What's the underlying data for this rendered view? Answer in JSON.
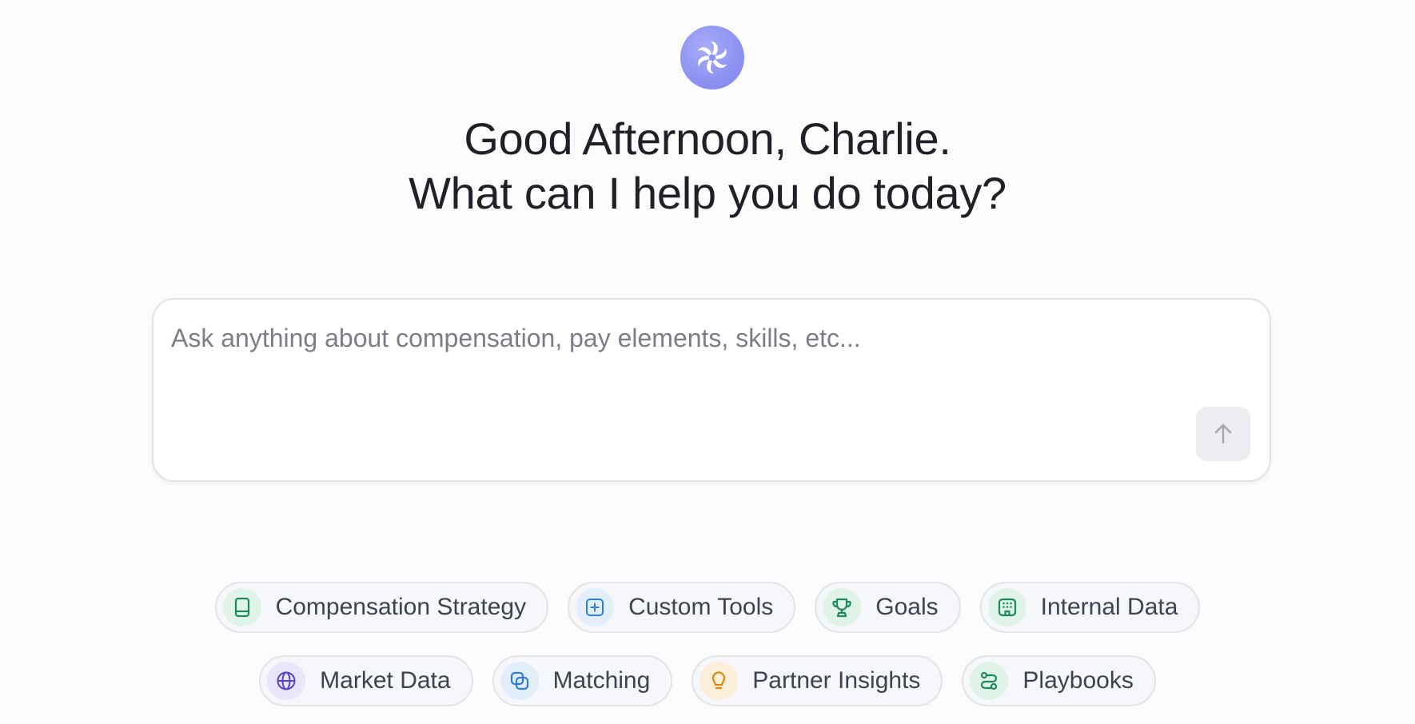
{
  "greeting": {
    "line1": "Good Afternoon, Charlie.",
    "line2": "What can I help you do today?"
  },
  "composer": {
    "placeholder": "Ask anything about compensation, pay elements, skills, etc...",
    "value": "",
    "send_icon": "arrow-up-icon"
  },
  "suggestions": {
    "row1": [
      {
        "label": "Compensation Strategy",
        "icon": "book-icon",
        "color": "#1f8a5b",
        "bg": "#dff3e8"
      },
      {
        "label": "Custom Tools",
        "icon": "plus-square-icon",
        "color": "#2f7fd8",
        "bg": "#e3eefb"
      },
      {
        "label": "Goals",
        "icon": "trophy-icon",
        "color": "#1f8a5b",
        "bg": "#dff3e8"
      },
      {
        "label": "Internal Data",
        "icon": "building-grid-icon",
        "color": "#1f8a5b",
        "bg": "#dff3e8"
      }
    ],
    "row2": [
      {
        "label": "Market Data",
        "icon": "globe-icon",
        "color": "#5a3fd0",
        "bg": "#e9e5fa"
      },
      {
        "label": "Matching",
        "icon": "overlap-squares-icon",
        "color": "#2f7fd8",
        "bg": "#e3eefb"
      },
      {
        "label": "Partner Insights",
        "icon": "lightbulb-icon",
        "color": "#d98a12",
        "bg": "#fcefd9"
      },
      {
        "label": "Playbooks",
        "icon": "route-icon",
        "color": "#1f8a5b",
        "bg": "#dff3e8"
      }
    ]
  },
  "colors": {
    "logo": "#8e94f2",
    "text": "#1f2129",
    "chip_border": "#e2e3e8"
  }
}
